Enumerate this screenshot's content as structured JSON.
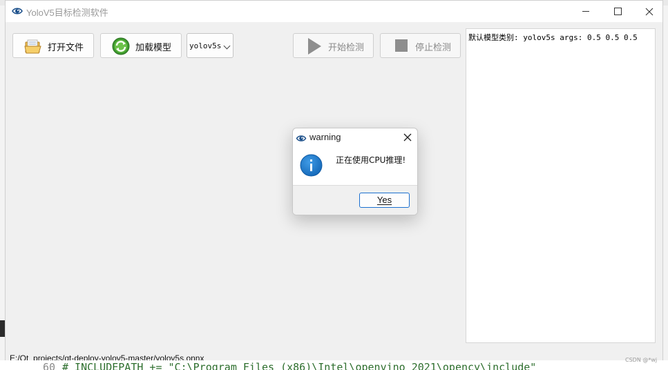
{
  "window": {
    "title": "YoloV5目标检测软件",
    "controls": {
      "minimize": "—",
      "maximize": "☐",
      "close": "✕"
    }
  },
  "toolbar": {
    "open_label": "打开文件",
    "load_label": "加载模型",
    "model_selected": "yolov5s",
    "start_label": "开始检测",
    "stop_label": "停止检测"
  },
  "info_panel": {
    "text": "默认模型类别: yolov5s args: 0.5 0.5 0.5"
  },
  "status": {
    "path": "E:/Qt_projects/qt-deploy-yolov5-master/yolov5s.onnx"
  },
  "dialog": {
    "title": "warning",
    "message": "正在使用CPU推理!",
    "yes_label": "Yes",
    "close_glyph": "✕",
    "icon": "information-icon"
  },
  "background": {
    "line_number": "60",
    "code": "#    INCLUDEPATH += \"C:\\Program Files (x86)\\Intel\\openvino_2021\\opency\\include\""
  },
  "watermark": "CSDN @*wj",
  "colors": {
    "accent": "#1a6fcf",
    "info_blue": "#1979ca",
    "disabled_text": "#8a8a8a"
  }
}
